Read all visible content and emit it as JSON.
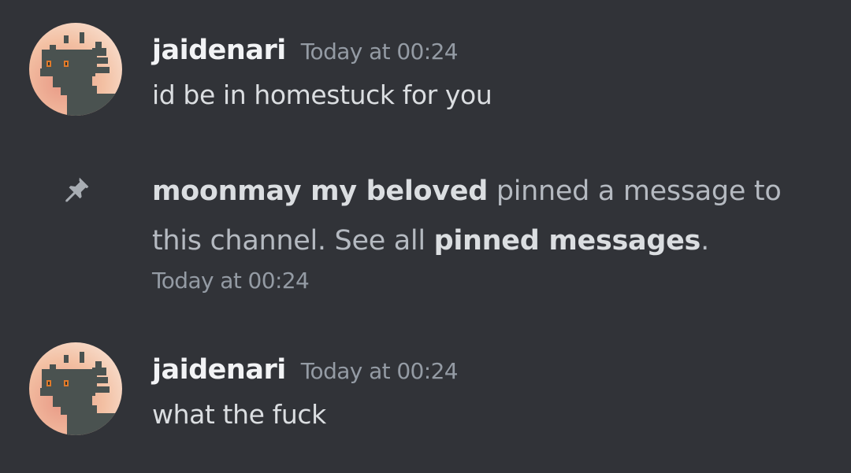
{
  "messages": [
    {
      "username": "jaidenari",
      "timestamp": "Today at 00:24",
      "content": "id be in homestuck for you",
      "avatar_icon": "dragon-avatar-icon"
    },
    {
      "username": "jaidenari",
      "timestamp": "Today at 00:24",
      "content": "what the fuck",
      "avatar_icon": "dragon-avatar-icon"
    }
  ],
  "system_message": {
    "icon": "pin-icon",
    "actor": "moonmay my beloved",
    "action_text": " pinned a message to this channel. See all ",
    "link_text": "pinned messages",
    "trailing": ".",
    "timestamp": "Today at 00:24"
  },
  "colors": {
    "background": "#313338",
    "username": "#f2f3f5",
    "timestamp": "#949ba4",
    "text": "#dbdee1",
    "system_text": "#b5bac1",
    "avatar_bg": "#f0b49a",
    "dragon": "#4a5250",
    "dragon_eye": "#e07a2a"
  }
}
